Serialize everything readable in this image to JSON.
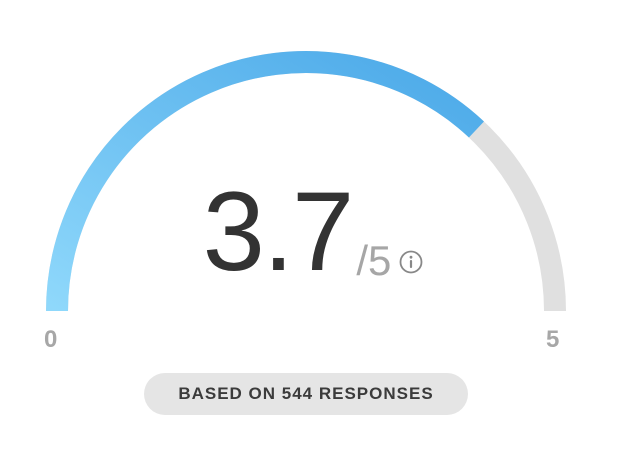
{
  "gauge": {
    "min_label": "0",
    "max_label": "5",
    "min_value": 0,
    "max_value": 5,
    "score": 3.7,
    "score_label": "3.7",
    "max_suffix": "/5",
    "fill_color_start": "#8fd8fb",
    "fill_color_end": "#4aa8e8",
    "track_color": "#e0e0e0",
    "info_icon": "info-circle-icon"
  },
  "summary": {
    "responses_label": "BASED ON 544 RESPONSES"
  }
}
